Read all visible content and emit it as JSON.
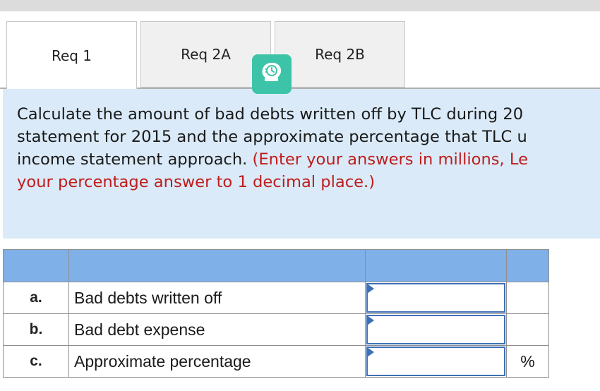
{
  "tabs": [
    {
      "label": "Req 1",
      "active": true
    },
    {
      "label": "Req 2A",
      "active": false
    },
    {
      "label": "Req 2B",
      "active": false
    }
  ],
  "hint_icon": "lightbulb-clock-icon",
  "question": {
    "line1": "Calculate the amount of bad debts written off by TLC during 20",
    "line2": "statement for 2015 and the approximate percentage that TLC u",
    "line3_normal": "income statement approach. ",
    "line3_red": "(Enter your answers in millions, Le",
    "line4_red": "your percentage answer to 1 decimal place.)"
  },
  "table": {
    "rows": [
      {
        "letter": "a.",
        "description": "Bad debts written off",
        "value": "",
        "unit": ""
      },
      {
        "letter": "b.",
        "description": "Bad debt expense",
        "value": "",
        "unit": ""
      },
      {
        "letter": "c.",
        "description": "Approximate percentage",
        "value": "",
        "unit": "%"
      }
    ]
  },
  "colors": {
    "tab_bg": "#f0f0f0",
    "question_bg": "#daeaf8",
    "instruction_red": "#bf1d1d",
    "table_header": "#7fb0e8",
    "input_border": "#3f70b5",
    "hint_teal": "#3dc4a8"
  }
}
